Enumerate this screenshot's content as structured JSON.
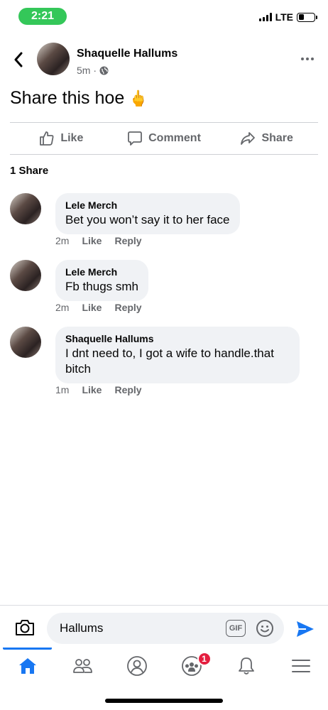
{
  "status_bar": {
    "time": "2:21",
    "network": "LTE",
    "battery_level": 0.35,
    "time_pill_color": "#34c759"
  },
  "post": {
    "author": "Shaquelle Hallums",
    "meta": "5m ·",
    "privacy_icon": "globe-icon",
    "text": "Share this hoe",
    "emoji": "🖕"
  },
  "actions": {
    "like": "Like",
    "comment": "Comment",
    "share": "Share"
  },
  "share_count": "1 Share",
  "comments": [
    {
      "author": "Lele Merch",
      "text": "Bet you won’t say it to her face",
      "time": "2m",
      "like": "Like",
      "reply": "Reply"
    },
    {
      "author": "Lele Merch",
      "text": "Fb thugs smh",
      "time": "2m",
      "like": "Like",
      "reply": "Reply"
    },
    {
      "author": "Shaquelle Hallums",
      "text": "I dnt need to, I got a wife to handle.that bitch",
      "time": "1m",
      "like": "Like",
      "reply": "Reply"
    }
  ],
  "composer": {
    "value": "Hallums",
    "gif_label": "GIF"
  },
  "tabs": [
    {
      "icon": "home-icon",
      "active": true
    },
    {
      "icon": "friends-icon",
      "active": false
    },
    {
      "icon": "profile-icon",
      "active": false
    },
    {
      "icon": "groups-icon",
      "active": false,
      "badge": "1"
    },
    {
      "icon": "bell-icon",
      "active": false
    },
    {
      "icon": "menu-icon",
      "active": false
    }
  ],
  "colors": {
    "accent": "#1877f2",
    "badge": "#e41e3f",
    "bubble": "#f0f2f5",
    "secondary_text": "#65676b"
  }
}
